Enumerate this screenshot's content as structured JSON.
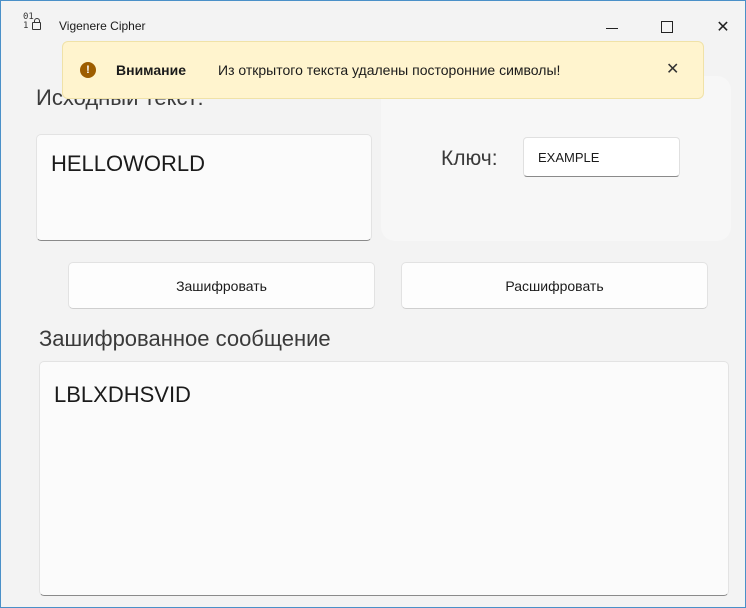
{
  "window": {
    "title": "Vigenere Cipher",
    "icon_text": "01\n10"
  },
  "infobar": {
    "title": "Внимание",
    "message": "Из открытого текста удалены посторонние символы!",
    "icon": "exclamation-icon",
    "close_icon": "close-icon"
  },
  "source": {
    "label": "Исходный текст:",
    "value": "HELLOWORLD"
  },
  "key": {
    "label": "Ключ:",
    "value": "EXAMPLE"
  },
  "buttons": {
    "encrypt": "Зашифровать",
    "decrypt": "Расшифровать"
  },
  "output": {
    "label": "Зашифрованное сообщение",
    "value": "LBLXDHSVID"
  },
  "colors": {
    "infobar_bg": "#fff4ce",
    "info_icon": "#9d5d00",
    "window_border": "#4a90c8"
  }
}
